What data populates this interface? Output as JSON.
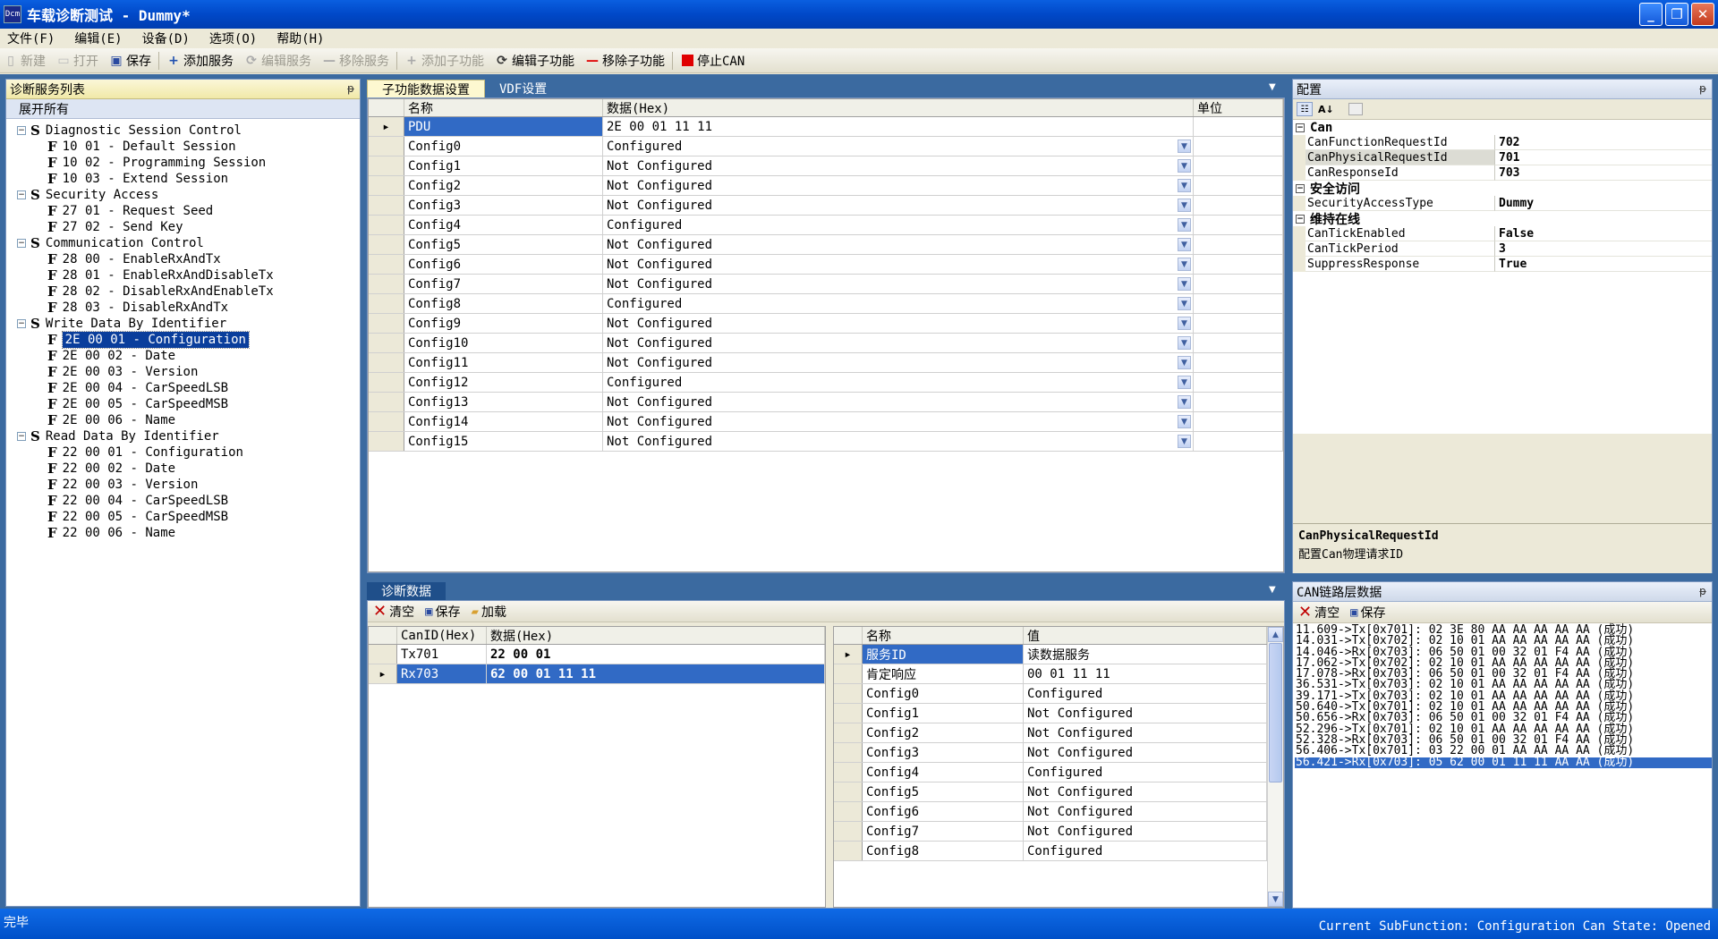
{
  "window": {
    "title": "车载诊断测试  - Dummy*",
    "app_icon": "Dcm"
  },
  "menu": [
    "文件(F)",
    "编辑(E)",
    "设备(D)",
    "选项(O)",
    "帮助(H)"
  ],
  "toolbar": {
    "new": "新建",
    "open": "打开",
    "save": "保存",
    "add_service": "添加服务",
    "edit_service": "编辑服务",
    "remove_service": "移除服务",
    "add_sub": "添加子功能",
    "edit_sub": "编辑子功能",
    "remove_sub": "移除子功能",
    "stop_can": "停止CAN"
  },
  "service_panel": {
    "title": "诊断服务列表",
    "expand_all": "展开所有",
    "services": [
      {
        "label": "Diagnostic Session Control",
        "subs": [
          "10 01 - Default Session",
          "10 02 - Programming Session",
          "10 03 - Extend Session"
        ]
      },
      {
        "label": "Security Access",
        "subs": [
          "27 01 - Request Seed",
          "27 02 - Send Key"
        ]
      },
      {
        "label": "Communication Control",
        "subs": [
          "28 00 - EnableRxAndTx",
          "28 01 - EnableRxAndDisableTx",
          "28 02 - DisableRxAndEnableTx",
          "28 03 - DisableRxAndTx"
        ]
      },
      {
        "label": "Write Data By Identifier",
        "subs": [
          "2E 00 01 - Configuration",
          "2E 00 02 - Date",
          "2E 00 03 - Version",
          "2E 00 04 - CarSpeedLSB",
          "2E 00 05 - CarSpeedMSB",
          "2E 00 06 - Name"
        ]
      },
      {
        "label": "Read Data By Identifier",
        "subs": [
          "22 00 01 - Configuration",
          "22 00 02 - Date",
          "22 00 03 - Version",
          "22 00 04 - CarSpeedLSB",
          "22 00 05 - CarSpeedMSB",
          "22 00 06 - Name"
        ]
      }
    ],
    "selected": "2E 00 01 - Configuration"
  },
  "subfunc": {
    "tabs": [
      "子功能数据设置",
      "VDF设置"
    ],
    "columns": [
      "名称",
      "数据(Hex)",
      "单位"
    ],
    "pdu": {
      "name": "PDU",
      "value": "2E 00 01 11 11"
    },
    "rows": [
      {
        "name": "Config0",
        "value": "Configured"
      },
      {
        "name": "Config1",
        "value": "Not Configured"
      },
      {
        "name": "Config2",
        "value": "Not Configured"
      },
      {
        "name": "Config3",
        "value": "Not Configured"
      },
      {
        "name": "Config4",
        "value": "Configured"
      },
      {
        "name": "Config5",
        "value": "Not Configured"
      },
      {
        "name": "Config6",
        "value": "Not Configured"
      },
      {
        "name": "Config7",
        "value": "Not Configured"
      },
      {
        "name": "Config8",
        "value": "Configured"
      },
      {
        "name": "Config9",
        "value": "Not Configured"
      },
      {
        "name": "Config10",
        "value": "Not Configured"
      },
      {
        "name": "Config11",
        "value": "Not Configured"
      },
      {
        "name": "Config12",
        "value": "Configured"
      },
      {
        "name": "Config13",
        "value": "Not Configured"
      },
      {
        "name": "Config14",
        "value": "Not Configured"
      },
      {
        "name": "Config15",
        "value": "Not Configured"
      }
    ]
  },
  "config_panel": {
    "title": "配置",
    "categories": [
      {
        "name": "Can",
        "props": [
          [
            "CanFunctionRequestId",
            "702"
          ],
          [
            "CanPhysicalRequestId",
            "701"
          ],
          [
            "CanResponseId",
            "703"
          ]
        ]
      },
      {
        "name": "安全访问",
        "props": [
          [
            "SecurityAccessType",
            "Dummy"
          ]
        ]
      },
      {
        "name": "维持在线",
        "props": [
          [
            "CanTickEnabled",
            "False"
          ],
          [
            "CanTickPeriod",
            "3"
          ],
          [
            "SuppressResponse",
            "True"
          ]
        ]
      }
    ],
    "help_title": "CanPhysicalRequestId",
    "help_desc": "配置Can物理请求ID"
  },
  "diag_panel": {
    "tab": "诊断数据",
    "clear": "清空",
    "save": "保存",
    "load": "加载",
    "left_columns": [
      "CanID(Hex)",
      "数据(Hex)"
    ],
    "left_rows": [
      [
        "Tx701",
        "22 00 01"
      ],
      [
        "Rx703",
        "62 00 01 11 11"
      ]
    ],
    "right_columns": [
      "名称",
      "值"
    ],
    "right_rows": [
      [
        "服务ID",
        "读数据服务"
      ],
      [
        "肯定响应",
        "00 01 11 11"
      ],
      [
        "Config0",
        "Configured"
      ],
      [
        "Config1",
        "Not Configured"
      ],
      [
        "Config2",
        "Not Configured"
      ],
      [
        "Config3",
        "Not Configured"
      ],
      [
        "Config4",
        "Configured"
      ],
      [
        "Config5",
        "Not Configured"
      ],
      [
        "Config6",
        "Not Configured"
      ],
      [
        "Config7",
        "Not Configured"
      ],
      [
        "Config8",
        "Configured"
      ]
    ]
  },
  "can_panel": {
    "title": "CAN链路层数据",
    "clear": "清空",
    "save": "保存",
    "log": [
      "11.609->Tx[0x701]: 02 3E 80 AA AA AA AA AA (成功)",
      "14.031->Tx[0x702]: 02 10 01 AA AA AA AA AA (成功)",
      "14.046->Rx[0x703]: 06 50 01 00 32 01 F4 AA (成功)",
      "17.062->Tx[0x702]: 02 10 01 AA AA AA AA AA (成功)",
      "17.078->Rx[0x703]: 06 50 01 00 32 01 F4 AA (成功)",
      "36.531->Tx[0x703]: 02 10 01 AA AA AA AA AA (成功)",
      "39.171->Tx[0x703]: 02 10 01 AA AA AA AA AA (成功)",
      "50.640->Tx[0x701]: 02 10 01 AA AA AA AA AA (成功)",
      "50.656->Rx[0x703]: 06 50 01 00 32 01 F4 AA (成功)",
      "52.296->Tx[0x701]: 02 10 01 AA AA AA AA AA (成功)",
      "52.328->Rx[0x703]: 06 50 01 00 32 01 F4 AA (成功)",
      "56.406->Tx[0x701]: 03 22 00 01 AA AA AA AA (成功)",
      "56.421->Rx[0x703]: 05 62 00 01 11 11 AA AA (成功)"
    ]
  },
  "status": {
    "left": "完毕",
    "right": "Current SubFunction: Configuration Can State: Opened"
  }
}
